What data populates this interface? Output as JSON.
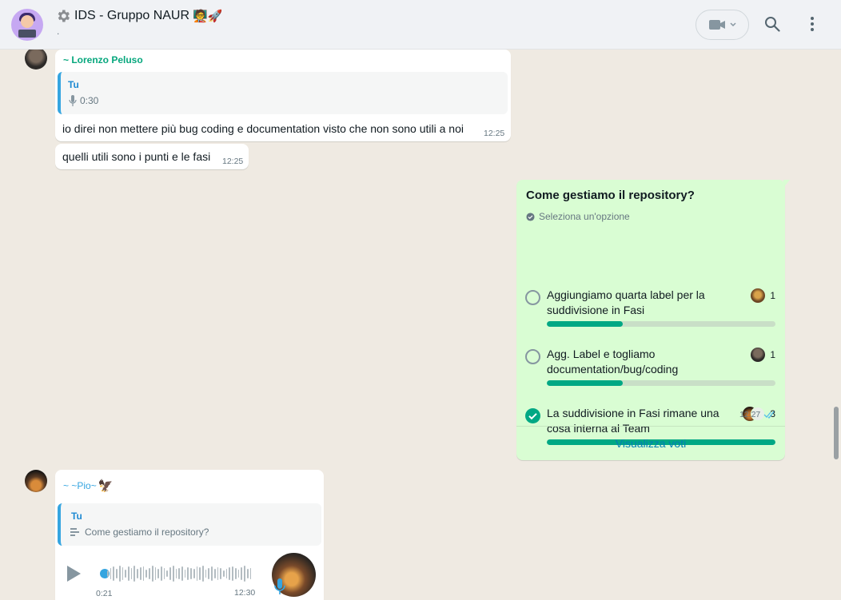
{
  "header": {
    "title": "IDS - Gruppo NAUR",
    "title_emoji": "🧑‍🏫🚀",
    "subtitle": "."
  },
  "messages": {
    "lorenzo": {
      "sender": "~ Lorenzo Peluso",
      "sender_color": "#06a77d",
      "quote_author": "Tu",
      "quote_audio_duration": "0:30",
      "text": "io direi non mettere più bug coding e documentation visto che non sono utili a noi",
      "time": "12:25"
    },
    "lorenzo_followup": {
      "text": "quelli utili sono i punti e le fasi",
      "time": "12:25"
    },
    "poll": {
      "question": "Come gestiamo il repository?",
      "hint": "Seleziona un'opzione",
      "options": [
        {
          "label": "Aggiungiamo quarta label per la suddivisione in Fasi",
          "votes": "1",
          "fraction": 0.333,
          "selected": false
        },
        {
          "label": "Agg. Label e togliamo documentation/bug/coding",
          "votes": "1",
          "fraction": 0.333,
          "selected": false
        },
        {
          "label": "La suddivisione in Fasi rimane una cosa interna al Team",
          "votes": "3",
          "fraction": 1.0,
          "selected": true
        }
      ],
      "time": "12:27",
      "view_votes": "Visualizza voti"
    },
    "pio": {
      "sender": "~ ~Pio~",
      "sender_emoji": "🦅",
      "sender_color": "#35a5e0",
      "quote_author": "Tu",
      "quote_text": "Come gestiamo il repository?",
      "audio_elapsed": "0:21",
      "time": "12:30"
    }
  },
  "colors": {
    "accent": "#00a884",
    "outgoing_bubble": "#d9fdd3",
    "incoming_bubble": "#ffffff",
    "chat_bg": "#efeae2",
    "link": "#027eb5",
    "read_ticks": "#53bdeb"
  }
}
